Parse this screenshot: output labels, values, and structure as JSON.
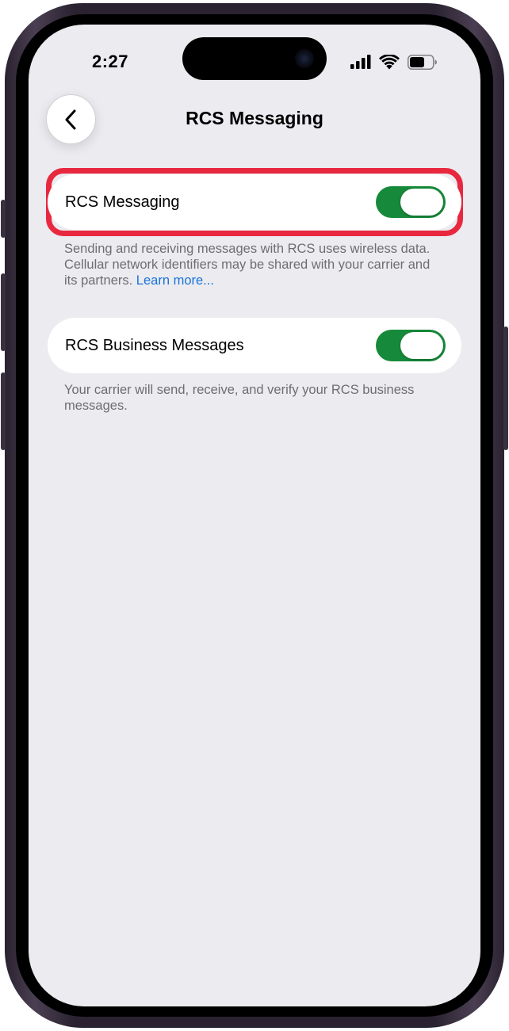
{
  "status_bar": {
    "time": "2:27",
    "signal_icon": "cellular-signal-icon",
    "wifi_icon": "wifi-icon",
    "battery_icon": "battery-icon"
  },
  "nav": {
    "back_icon": "chevron-left-icon",
    "title": "RCS Messaging"
  },
  "settings": [
    {
      "label": "RCS Messaging",
      "enabled": true,
      "highlighted": true,
      "footnote": "Sending and receiving messages with RCS uses wireless data. Cellular network identifiers may be shared with your carrier and its partners.",
      "footnote_link": "Learn more..."
    },
    {
      "label": "RCS Business Messages",
      "enabled": true,
      "highlighted": false,
      "footnote": "Your carrier will send, receive, and verify your RCS business messages."
    }
  ],
  "colors": {
    "toggle_on": "#168a3a",
    "highlight": "#e8283f",
    "link": "#1a73d9",
    "background": "#ebebf0"
  }
}
